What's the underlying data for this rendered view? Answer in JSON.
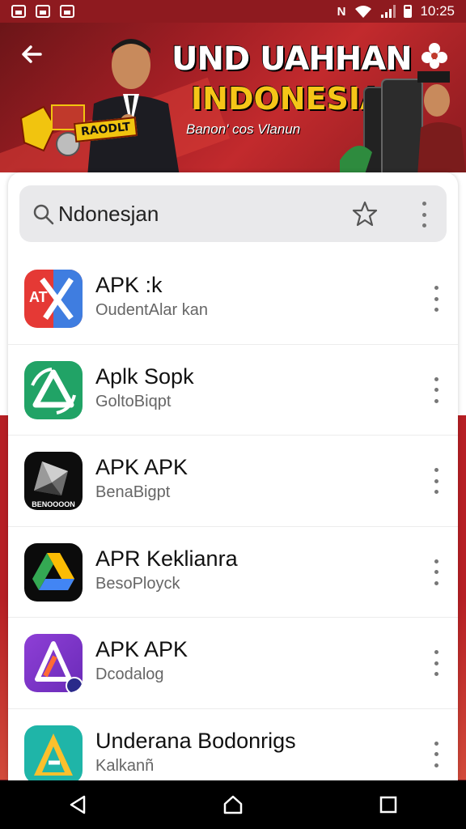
{
  "status_bar": {
    "time": "10:25",
    "icons": [
      "gallery-icon",
      "image-icon",
      "image-icon",
      "nfc-icon",
      "wifi-icon",
      "signal-icon",
      "battery-icon"
    ]
  },
  "banner": {
    "title": "UND UAHHAN",
    "subtitle": "INDONESIA",
    "tagline": "Banon' cos Vlanun",
    "badge_text": "RAODLT",
    "colors": {
      "background": "#a01e24",
      "title": "#ffffff",
      "subtitle": "#f5c518"
    }
  },
  "search": {
    "query": "Ndonesjan",
    "placeholder": ""
  },
  "apps": [
    {
      "name": "APK :k",
      "subtitle": "OudentAlar kan",
      "icon": "apk-x-icon"
    },
    {
      "name": "Aplk Sopk",
      "subtitle": "GoltoBiqpt",
      "icon": "recycle-a-icon"
    },
    {
      "name": "APK APK",
      "subtitle": "BenaBigpt",
      "icon": "prism-icon",
      "icon_label": "BENOOOON"
    },
    {
      "name": "APR Keklianra",
      "subtitle": "BesoPloyck",
      "icon": "drive-triangle-icon"
    },
    {
      "name": "APK APK",
      "subtitle": "Dcodalog",
      "icon": "purple-a-icon"
    },
    {
      "name": "Underana Bodonrigs",
      "subtitle": "Kalkanñ",
      "icon": "teal-a-icon"
    }
  ],
  "nav": {
    "items": [
      "back-icon",
      "home-icon",
      "recents-icon"
    ]
  }
}
